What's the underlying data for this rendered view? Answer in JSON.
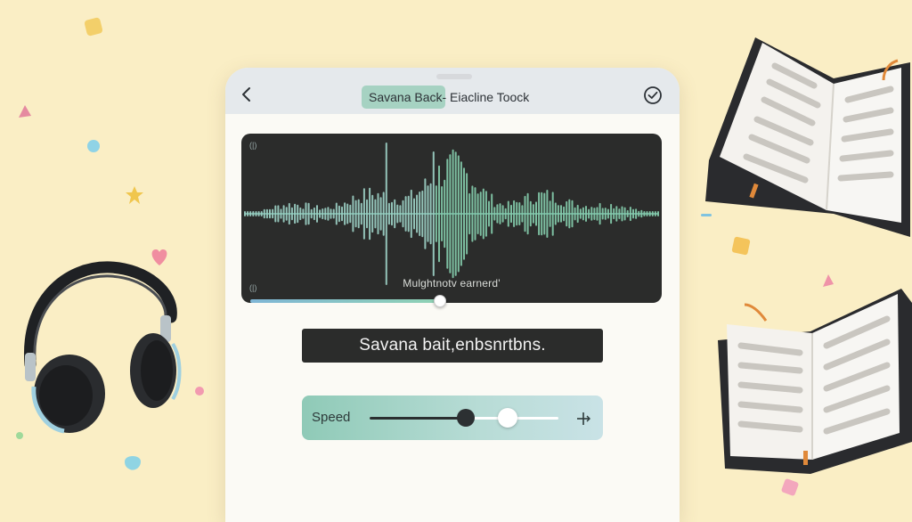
{
  "header": {
    "title": "Savana Back- Eiacline Toock",
    "back_icon": "chevron-left-icon",
    "done_icon": "check-circle-icon"
  },
  "waveform": {
    "caption": "Mulghtnotv earnerd'",
    "top_left_mark": "(|)",
    "bottom_left_mark": "(|)",
    "playback_progress": 0.46
  },
  "transcript": {
    "text": "Savana bait,enbsnrtbns."
  },
  "speed": {
    "label": "Speed",
    "value_fraction": 0.51,
    "secondary_fraction": 0.73,
    "plus_icon": "plus-icon"
  },
  "colors": {
    "background": "#faeec5",
    "accent_mint": "#8fcab7",
    "wave_teal": "#8fd2b4",
    "panel_dark": "#2b2c2b"
  },
  "decor": {
    "left_icon": "headphones-icon",
    "right_icons": [
      "open-book-icon",
      "open-book-icon"
    ]
  }
}
